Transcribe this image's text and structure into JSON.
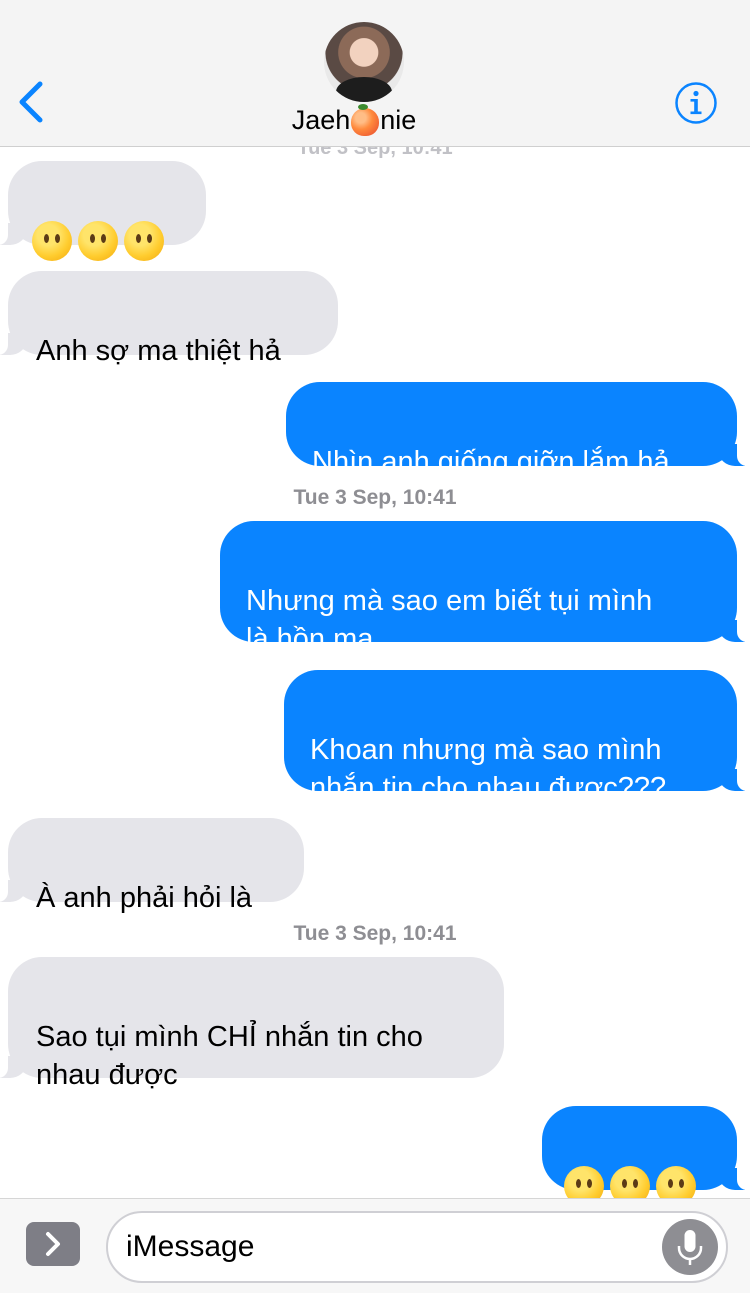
{
  "header": {
    "contact_name_part1": "Jaeh",
    "contact_name_part2": "nie",
    "contact_name_emoji": "peach-emoji"
  },
  "messages": [
    {
      "id": 1,
      "direction": "in",
      "type": "emoji",
      "emoji": [
        "neutral-face",
        "neutral-face",
        "neutral-face"
      ]
    },
    {
      "id": 2,
      "direction": "in",
      "type": "text",
      "text": "Anh sợ ma thiệt hả"
    },
    {
      "id": 3,
      "direction": "out",
      "type": "text",
      "text": "Nhìn anh giống giỡn lắm hả"
    },
    {
      "id": 4,
      "type": "timestamp",
      "text": "Tue 3 Sep, 10:41"
    },
    {
      "id": 5,
      "direction": "out",
      "type": "text",
      "text": "Nhưng mà sao em biết tụi mình\nlà hồn ma"
    },
    {
      "id": 6,
      "direction": "out",
      "type": "text",
      "text": "Khoan nhưng mà sao mình\nnhắn tin cho nhau được???"
    },
    {
      "id": 7,
      "direction": "in",
      "type": "text",
      "text": "À anh phải hỏi là"
    },
    {
      "id": 8,
      "type": "timestamp",
      "text": "Tue 3 Sep, 10:41"
    },
    {
      "id": 9,
      "direction": "in",
      "type": "text",
      "text": "Sao tụi mình CHỈ nhắn tin cho\nnhau được"
    },
    {
      "id": 10,
      "direction": "out",
      "type": "emoji",
      "emoji": [
        "neutral-face",
        "neutral-face",
        "neutral-face"
      ]
    }
  ],
  "composer": {
    "placeholder": "iMessage"
  },
  "icons": {
    "back": "chevron-left-icon",
    "info": "info-icon",
    "apps": "chevron-right-icon",
    "mic": "microphone-icon"
  },
  "colors": {
    "outgoing_bubble": "#0a84ff",
    "incoming_bubble": "#e5e5ea",
    "accent": "#0a84ff"
  }
}
